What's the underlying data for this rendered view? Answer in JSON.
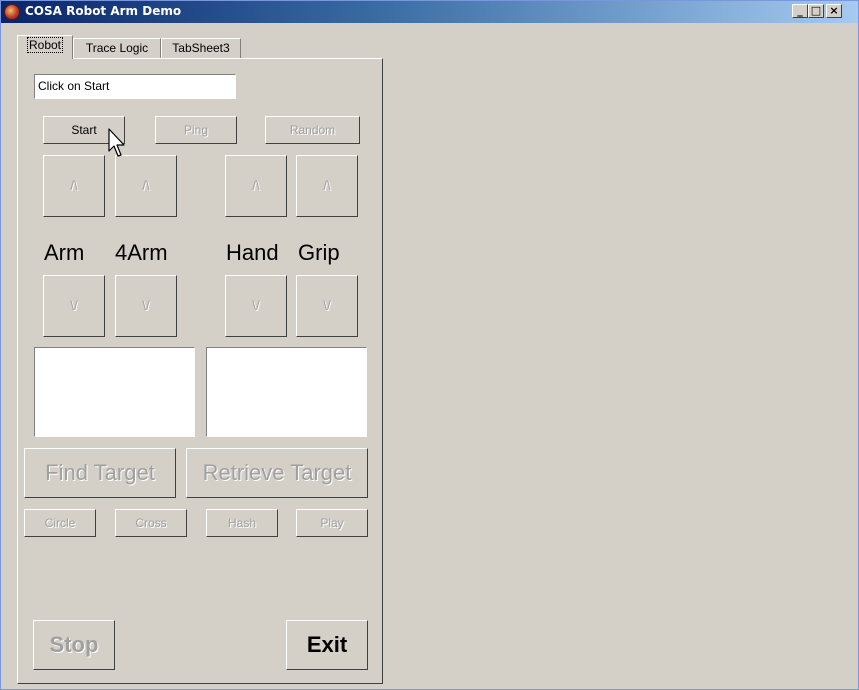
{
  "window": {
    "title": "COSA Robot Arm Demo",
    "controls": {
      "minimize": "_",
      "maximize": "□",
      "close": "×"
    }
  },
  "tabs": [
    {
      "label": "Robot",
      "active": true
    },
    {
      "label": "Trace Logic",
      "active": false
    },
    {
      "label": "TabSheet3",
      "active": false
    }
  ],
  "robot": {
    "status_text": "Click on Start",
    "top_buttons": {
      "start": "Start",
      "ping": "Ping",
      "random": "Random"
    },
    "up_arrow": "/\\",
    "down_arrow": "\\/",
    "joint_labels": {
      "arm": "Arm",
      "forearm": "4Arm",
      "hand": "Hand",
      "grip": "Grip"
    },
    "target_buttons": {
      "find": "Find Target",
      "retrieve": "Retrieve Target"
    },
    "shape_buttons": {
      "circle": "Circle",
      "cross": "Cross",
      "hash": "Hash",
      "play": "Play"
    },
    "bottom_buttons": {
      "stop": "Stop",
      "exit": "Exit"
    }
  }
}
